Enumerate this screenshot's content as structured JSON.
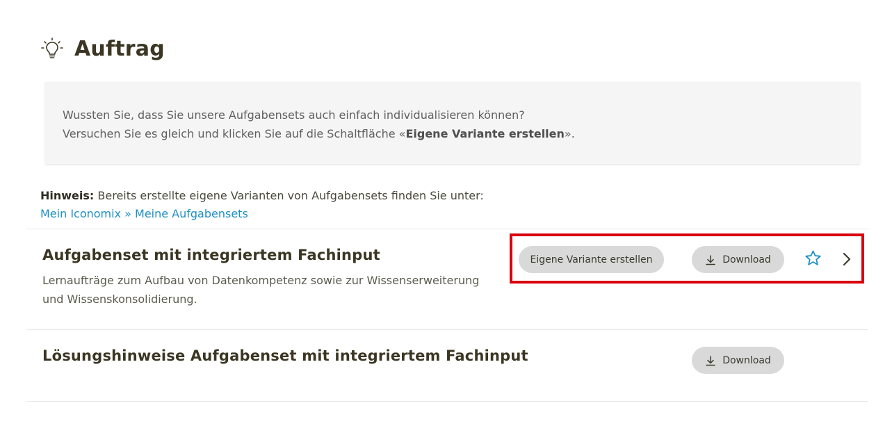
{
  "page": {
    "title": "Auftrag"
  },
  "info": {
    "line1": "Wussten Sie, dass Sie unsere Aufgabensets auch einfach individualisieren können?",
    "line2_prefix": "Versuchen Sie es gleich und klicken Sie auf die Schaltfläche «",
    "line2_bold": "Eigene Variante erstellen",
    "line2_suffix": "»."
  },
  "hint": {
    "label": "Hinweis:",
    "text": " Bereits erstellte eigene Varianten von Aufgabensets finden Sie unter:",
    "link": "Mein Iconomix » Meine Aufgabensets"
  },
  "items": [
    {
      "title": "Aufgabenset mit integriertem Fachinput",
      "description": "Lernaufträge zum Aufbau von Datenkompetenz sowie zur Wissenserweiterung und Wissenskonsolidierung.",
      "variant_label": "Eigene Variante erstellen",
      "download_label": "Download"
    },
    {
      "title": "Lösungshinweise Aufgabenset mit integriertem Fachinput",
      "download_label": "Download"
    }
  ],
  "icons": {
    "bulb": "lightbulb-icon",
    "download": "download-icon",
    "star": "star-outline-icon",
    "chevron": "chevron-right-icon"
  },
  "colors": {
    "link": "#1e8fc3",
    "star": "#1e8fc3",
    "highlight": "#d9000d",
    "button_bg": "#d9d9d9"
  }
}
